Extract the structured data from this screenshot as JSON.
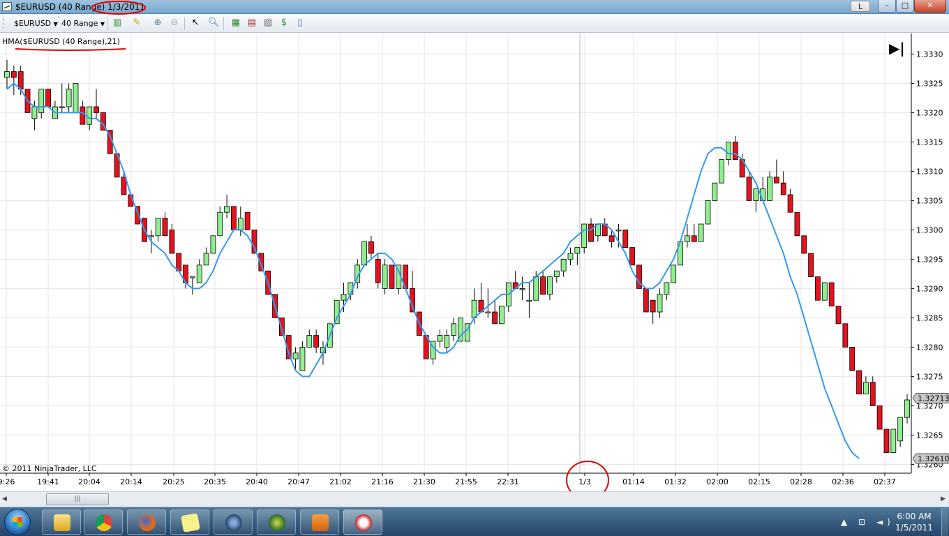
{
  "window": {
    "title": "$EURUSD (40 Range) 1/3/2011",
    "l_button": "L",
    "minimize": "–",
    "maximize": "□",
    "close": "✕"
  },
  "toolbar": {
    "instrument": "$EURUSD",
    "interval": "40 Range",
    "dropdown_arrow": "▼"
  },
  "chart": {
    "indicator_label": "HMA($EURUSD (40 Range),21)",
    "copyright": "© 2011 NinjaTrader, LLC",
    "go_to_end_label": "▶|",
    "colors": {
      "up_candle": "#90ee90",
      "down_candle": "#e4121e",
      "hma_line": "#3399ee",
      "grid": "#e4e4e4",
      "annotation": "#e00000"
    }
  },
  "chart_data": {
    "type": "candlestick",
    "y_ticks": [
      "1.3330",
      "1.3325",
      "1.3320",
      "1.3315",
      "1.3310",
      "1.3305",
      "1.3300",
      "1.3295",
      "1.3290",
      "1.3285",
      "1.3280",
      "1.3275",
      "1.3270",
      "1.3265",
      "1.3260"
    ],
    "x_ticks": [
      "9:26",
      "19:41",
      "20:04",
      "20:14",
      "20:25",
      "20:35",
      "20:40",
      "20:47",
      "21:02",
      "21:16",
      "21:30",
      "21:55",
      "22:31",
      "1/3",
      "01:14",
      "01:32",
      "02:00",
      "02:15",
      "02:28",
      "02:36",
      "02:37"
    ],
    "price_markers": [
      "1.32713",
      "1.32610"
    ],
    "ylim": [
      1.32585,
      1.33335
    ],
    "candles": [
      [
        1.3326,
        1.3329,
        1.3324,
        1.3327
      ],
      [
        1.3327,
        1.3328,
        1.3323,
        1.3326
      ],
      [
        1.3327,
        1.3328,
        1.3323,
        1.3324
      ],
      [
        1.3324,
        1.3324,
        1.332,
        1.332
      ],
      [
        1.3319,
        1.3322,
        1.3317,
        1.3321
      ],
      [
        1.332,
        1.3324,
        1.3319,
        1.3324
      ],
      [
        1.3324,
        1.3324,
        1.3321,
        1.3321
      ],
      [
        1.3319,
        1.3322,
        1.3319,
        1.3321
      ],
      [
        1.3321,
        1.3325,
        1.332,
        1.3321
      ],
      [
        1.3321,
        1.3325,
        1.332,
        1.3324
      ],
      [
        1.332,
        1.3325,
        1.332,
        1.3325
      ],
      [
        1.3321,
        1.3322,
        1.3318,
        1.3318
      ],
      [
        1.3318,
        1.3321,
        1.3317,
        1.3321
      ],
      [
        1.3321,
        1.3324,
        1.3319,
        1.332
      ],
      [
        1.332,
        1.332,
        1.3317,
        1.3317
      ],
      [
        1.3317,
        1.3317,
        1.3313,
        1.3313
      ],
      [
        1.3313,
        1.3313,
        1.3309,
        1.3309
      ],
      [
        1.3309,
        1.331,
        1.3306,
        1.3306
      ],
      [
        1.3306,
        1.3306,
        1.3304,
        1.3304
      ],
      [
        1.3304,
        1.3304,
        1.3301,
        1.3301
      ],
      [
        1.3302,
        1.3302,
        1.3298,
        1.3298
      ],
      [
        1.3299,
        1.33,
        1.3296,
        1.3299
      ],
      [
        1.3299,
        1.3302,
        1.3298,
        1.3302
      ],
      [
        1.3302,
        1.3303,
        1.3299,
        1.3299
      ],
      [
        1.33,
        1.3301,
        1.3296,
        1.3296
      ],
      [
        1.3296,
        1.3296,
        1.3293,
        1.3293
      ],
      [
        1.3294,
        1.3294,
        1.329,
        1.3291
      ],
      [
        1.3292,
        1.3292,
        1.3289,
        1.3292
      ],
      [
        1.3291,
        1.3295,
        1.3291,
        1.3294
      ],
      [
        1.3294,
        1.3297,
        1.3294,
        1.3296
      ],
      [
        1.3296,
        1.3299,
        1.3296,
        1.3299
      ],
      [
        1.3299,
        1.3304,
        1.3299,
        1.3303
      ],
      [
        1.3303,
        1.3306,
        1.3302,
        1.3304
      ],
      [
        1.3304,
        1.3304,
        1.33,
        1.33
      ],
      [
        1.33,
        1.3304,
        1.3299,
        1.3302
      ],
      [
        1.3303,
        1.3303,
        1.33,
        1.33
      ],
      [
        1.33,
        1.33,
        1.3296,
        1.3296
      ],
      [
        1.3296,
        1.3296,
        1.3293,
        1.3293
      ],
      [
        1.3293,
        1.3293,
        1.3289,
        1.3289
      ],
      [
        1.3289,
        1.3289,
        1.3285,
        1.3285
      ],
      [
        1.3285,
        1.3285,
        1.3282,
        1.3282
      ],
      [
        1.3282,
        1.3282,
        1.3278,
        1.3278
      ],
      [
        1.3278,
        1.328,
        1.3276,
        1.3279
      ],
      [
        1.3276,
        1.3281,
        1.3276,
        1.328
      ],
      [
        1.328,
        1.3283,
        1.328,
        1.3282
      ],
      [
        1.3282,
        1.3283,
        1.3279,
        1.328
      ],
      [
        1.3279,
        1.3281,
        1.3277,
        1.328
      ],
      [
        1.328,
        1.3284,
        1.328,
        1.3284
      ],
      [
        1.3284,
        1.3288,
        1.3284,
        1.3288
      ],
      [
        1.3288,
        1.3291,
        1.3286,
        1.3289
      ],
      [
        1.3289,
        1.3291,
        1.3288,
        1.3291
      ],
      [
        1.3291,
        1.3295,
        1.329,
        1.3294
      ],
      [
        1.3294,
        1.3298,
        1.3294,
        1.3298
      ],
      [
        1.3298,
        1.3299,
        1.3295,
        1.3296
      ],
      [
        1.3295,
        1.3296,
        1.329,
        1.3291
      ],
      [
        1.329,
        1.3295,
        1.3289,
        1.3294
      ],
      [
        1.3294,
        1.3294,
        1.329,
        1.329
      ],
      [
        1.329,
        1.3294,
        1.3289,
        1.3294
      ],
      [
        1.3294,
        1.3294,
        1.329,
        1.329
      ],
      [
        1.329,
        1.3293,
        1.3286,
        1.3286
      ],
      [
        1.3286,
        1.3286,
        1.3282,
        1.3282
      ],
      [
        1.3282,
        1.3282,
        1.3278,
        1.3278
      ],
      [
        1.3278,
        1.3281,
        1.3277,
        1.3281
      ],
      [
        1.3281,
        1.3283,
        1.328,
        1.3282
      ],
      [
        1.328,
        1.3283,
        1.3279,
        1.3282
      ],
      [
        1.3282,
        1.3285,
        1.3281,
        1.3284
      ],
      [
        1.3281,
        1.3285,
        1.3281,
        1.3285
      ],
      [
        1.3281,
        1.3284,
        1.3281,
        1.3284
      ],
      [
        1.3285,
        1.329,
        1.3284,
        1.3288
      ],
      [
        1.3288,
        1.3291,
        1.3286,
        1.3286
      ],
      [
        1.3286,
        1.329,
        1.3285,
        1.3286
      ],
      [
        1.3286,
        1.3288,
        1.3285,
        1.3284
      ],
      [
        1.3284,
        1.3287,
        1.3284,
        1.3287
      ],
      [
        1.3287,
        1.3291,
        1.3286,
        1.3291
      ],
      [
        1.3291,
        1.3293,
        1.329,
        1.329
      ],
      [
        1.329,
        1.3292,
        1.3288,
        1.329
      ],
      [
        1.3288,
        1.3291,
        1.3285,
        1.3288
      ],
      [
        1.3288,
        1.3293,
        1.3288,
        1.3292
      ],
      [
        1.3292,
        1.3293,
        1.3289,
        1.3289
      ],
      [
        1.3289,
        1.3292,
        1.3288,
        1.3292
      ],
      [
        1.3292,
        1.3293,
        1.3291,
        1.3293
      ],
      [
        1.3293,
        1.3295,
        1.3292,
        1.3295
      ],
      [
        1.3295,
        1.3297,
        1.3294,
        1.3296
      ],
      [
        1.3296,
        1.3297,
        1.3294,
        1.3297
      ],
      [
        1.3297,
        1.3301,
        1.3296,
        1.3301
      ],
      [
        1.3301,
        1.3302,
        1.3299,
        1.3298
      ],
      [
        1.3299,
        1.3301,
        1.3298,
        1.3301
      ],
      [
        1.3301,
        1.3302,
        1.3299,
        1.3299
      ],
      [
        1.3299,
        1.33,
        1.3297,
        1.3298
      ],
      [
        1.33,
        1.3301,
        1.3297,
        1.33
      ],
      [
        1.33,
        1.33,
        1.3297,
        1.3297
      ],
      [
        1.3297,
        1.3297,
        1.3294,
        1.3294
      ],
      [
        1.3294,
        1.3294,
        1.329,
        1.329
      ],
      [
        1.329,
        1.329,
        1.3286,
        1.3286
      ],
      [
        1.3288,
        1.3288,
        1.3284,
        1.3286
      ],
      [
        1.3286,
        1.329,
        1.3285,
        1.3289
      ],
      [
        1.3289,
        1.3291,
        1.3288,
        1.3291
      ],
      [
        1.3291,
        1.3294,
        1.3291,
        1.3294
      ],
      [
        1.3294,
        1.3298,
        1.3294,
        1.3298
      ],
      [
        1.3298,
        1.3301,
        1.3297,
        1.3299
      ],
      [
        1.3299,
        1.3301,
        1.3298,
        1.3298
      ],
      [
        1.3298,
        1.3301,
        1.3298,
        1.3301
      ],
      [
        1.3301,
        1.3305,
        1.3301,
        1.3305
      ],
      [
        1.3305,
        1.3308,
        1.3305,
        1.3308
      ],
      [
        1.3308,
        1.3312,
        1.3308,
        1.3312
      ],
      [
        1.3312,
        1.3315,
        1.3311,
        1.3315
      ],
      [
        1.3315,
        1.3316,
        1.3312,
        1.3312
      ],
      [
        1.3312,
        1.3313,
        1.3309,
        1.3309
      ],
      [
        1.3309,
        1.331,
        1.3305,
        1.3305
      ],
      [
        1.3305,
        1.3307,
        1.3303,
        1.3307
      ],
      [
        1.3305,
        1.3309,
        1.3305,
        1.3307
      ],
      [
        1.3305,
        1.331,
        1.3305,
        1.3309
      ],
      [
        1.3309,
        1.3312,
        1.3308,
        1.3308
      ],
      [
        1.3308,
        1.331,
        1.3306,
        1.3306
      ],
      [
        1.3306,
        1.3307,
        1.3303,
        1.3303
      ],
      [
        1.3303,
        1.3303,
        1.3299,
        1.3299
      ],
      [
        1.3299,
        1.3299,
        1.3296,
        1.3296
      ],
      [
        1.3296,
        1.3296,
        1.3292,
        1.3292
      ],
      [
        1.3292,
        1.3292,
        1.3288,
        1.3288
      ],
      [
        1.3288,
        1.3291,
        1.3288,
        1.3291
      ],
      [
        1.3291,
        1.3291,
        1.3287,
        1.3287
      ],
      [
        1.3287,
        1.3287,
        1.3284,
        1.3284
      ],
      [
        1.3284,
        1.3284,
        1.328,
        1.328
      ],
      [
        1.328,
        1.328,
        1.3276,
        1.3276
      ],
      [
        1.3276,
        1.3276,
        1.3272,
        1.3272
      ],
      [
        1.3272,
        1.3275,
        1.3272,
        1.3274
      ],
      [
        1.3274,
        1.3275,
        1.327,
        1.327
      ],
      [
        1.327,
        1.327,
        1.3266,
        1.3266
      ],
      [
        1.3266,
        1.3266,
        1.3262,
        1.3262
      ],
      [
        1.3262,
        1.3266,
        1.3262,
        1.3266
      ],
      [
        1.3264,
        1.3268,
        1.3263,
        1.3268
      ],
      [
        1.3268,
        1.3272,
        1.3267,
        1.3271
      ]
    ],
    "hma": [
      1.3324,
      1.3325,
      1.3324,
      1.3322,
      1.3321,
      1.3321,
      1.3321,
      1.332,
      1.332,
      1.332,
      1.332,
      1.332,
      1.3319,
      1.3319,
      1.3318,
      1.3316,
      1.3313,
      1.331,
      1.3306,
      1.3303,
      1.33,
      1.3298,
      1.3297,
      1.3296,
      1.3294,
      1.3293,
      1.3291,
      1.329,
      1.329,
      1.3291,
      1.3293,
      1.3296,
      1.3298,
      1.33,
      1.33,
      1.3299,
      1.3297,
      1.3294,
      1.3291,
      1.3287,
      1.3283,
      1.3279,
      1.3276,
      1.3275,
      1.3275,
      1.3277,
      1.3279,
      1.3282,
      1.3285,
      1.3287,
      1.3289,
      1.3292,
      1.3294,
      1.3295,
      1.3296,
      1.3296,
      1.3295,
      1.3293,
      1.329,
      1.3287,
      1.3284,
      1.3282,
      1.328,
      1.3279,
      1.3279,
      1.328,
      1.3282,
      1.3283,
      1.3285,
      1.3286,
      1.3287,
      1.3288,
      1.3289,
      1.3289,
      1.329,
      1.3291,
      1.3291,
      1.3292,
      1.3293,
      1.3294,
      1.3295,
      1.3296,
      1.3298,
      1.3299,
      1.33,
      1.33,
      1.3301,
      1.3301,
      1.33,
      1.3298,
      1.3296,
      1.3293,
      1.3291,
      1.329,
      1.329,
      1.3291,
      1.3293,
      1.3295,
      1.3298,
      1.3302,
      1.3306,
      1.331,
      1.3313,
      1.3314,
      1.3314,
      1.3313,
      1.3313,
      1.3312,
      1.331,
      1.3308,
      1.3305,
      1.3302,
      1.3299,
      1.3296,
      1.3292,
      1.3289,
      1.3285,
      1.3281,
      1.3277,
      1.3273,
      1.327,
      1.3267,
      1.3264,
      1.3262,
      1.3261
    ]
  },
  "status": {
    "scroll_left": "◀",
    "scroll_right": "▶",
    "scroll_grip": "|||"
  },
  "taskbar": {
    "tray": "▲ ⊡ ◄)",
    "clock_time": "6:00 AM",
    "clock_date": "1/5/2011"
  }
}
